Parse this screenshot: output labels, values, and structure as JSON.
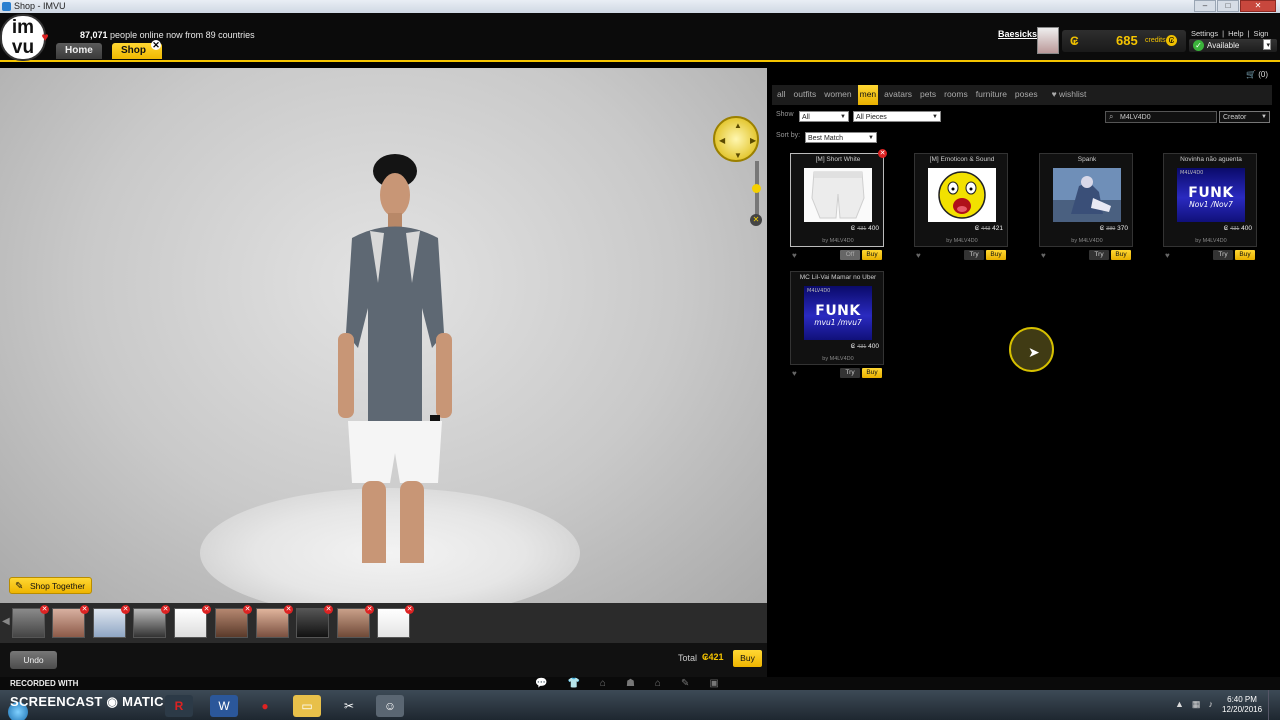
{
  "window": {
    "title": "Shop - IMVU"
  },
  "header": {
    "online_count": "87,071",
    "online_text": "people online now from 89 countries",
    "tabs": [
      {
        "label": "Home"
      },
      {
        "label": "Shop"
      }
    ],
    "username": "Baesicks",
    "credits_value": "685",
    "credits_label": "credits",
    "links": [
      "Settings",
      "|",
      "Help",
      "|",
      "Sign Out"
    ],
    "status": "Available",
    "accent": "#f5c400"
  },
  "stage": {
    "shop_together": "Shop Together",
    "undo": "Undo",
    "total_label": "Total",
    "total_value": "421",
    "buy": "Buy"
  },
  "shop": {
    "cart": "(0)",
    "categories": [
      "all",
      "outfits",
      "women",
      "men",
      "avatars",
      "pets",
      "rooms",
      "furniture",
      "poses",
      "wishlist"
    ],
    "active_category": "men",
    "show_label": "Show",
    "show_value": "All",
    "pieces_value": "All Pieces",
    "search_value": "M4LV4D0",
    "search_scope": "Creator",
    "sort_label": "Sort by:",
    "sort_value": "Best Match",
    "products": [
      {
        "title": "[M] Short White",
        "old_price": "431",
        "price": "400",
        "by": "by M4LV4D0",
        "try": "Off",
        "buy": "Buy"
      },
      {
        "title": "[M] Emoticon & Sound",
        "old_price": "443",
        "price": "421",
        "by": "by M4LV4D0",
        "try": "Try",
        "buy": "Buy"
      },
      {
        "title": "Spank",
        "old_price": "389",
        "price": "370",
        "by": "by M4LV4D0",
        "try": "Try",
        "buy": "Buy"
      },
      {
        "title": "Novinha não aguenta",
        "old_price": "431",
        "price": "400",
        "by": "by M4LV4D0",
        "try": "Try",
        "buy": "Buy",
        "image_top": "M4LV4D0",
        "image_main": "FUNK",
        "image_sub": "Nov1 /Nov7"
      },
      {
        "title": "MC Lil-Vai Mamar no Uber",
        "old_price": "431",
        "price": "400",
        "by": "by M4LV4D0",
        "try": "Try",
        "buy": "Buy",
        "image_top": "M4LV4D0",
        "image_main": "FUNK",
        "image_sub": "mvu1 /mvu7"
      }
    ]
  },
  "footer": {
    "recorded_with": "RECORDED WITH",
    "screencast": "SCREENCAST",
    "matic": "MATIC",
    "time": "6:40 PM",
    "date": "12/20/2016"
  }
}
